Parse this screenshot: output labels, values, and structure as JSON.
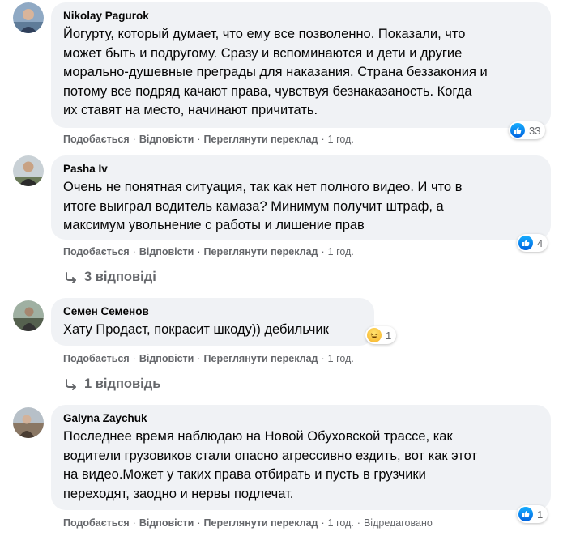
{
  "actions": {
    "like": "Подобається",
    "reply": "Відповісти",
    "translate": "Переглянути переклад"
  },
  "comments": [
    {
      "author": "Nikolay Pagurok",
      "lines": [
        "Йогурту, который думает, что ему все позволенно. Показали, что",
        "может быть и подругому. Сразу и вспоминаются и дети и другие",
        "морально-душевные преграды для наказания. Страна беззакония и",
        "потому все подряд качают права, чувствуя безнаказаность. Когда",
        "их ставят на место, начинают причитать."
      ],
      "time": "1 год.",
      "reactions": {
        "icon": "like-icon",
        "count": "33"
      }
    },
    {
      "author": "Pasha Iv",
      "lines": [
        "Очень не понятная ситуация, так как нет полного видео. И что в",
        "итоге выиграл водитель камаза? Минимум получит штраф, а",
        "максимум увольнение с работы и лишение прав"
      ],
      "time": "1 год.",
      "reactions": {
        "icon": "like-icon",
        "count": "4"
      },
      "replies": "3 відповіді"
    },
    {
      "author": "Семен Семенов",
      "lines": [
        "Хату Продаст, покрасит шкоду)) дебильчик"
      ],
      "time": "1 год.",
      "reactions": {
        "icon": "haha-icon",
        "count": "1"
      },
      "replies": "1 відповідь"
    },
    {
      "author": "Galyna Zaychuk",
      "lines": [
        "Последнее время наблюдаю на Новой Обуховской трассе, как",
        "водители грузовиков стали опасно агрессивно ездить, вот как этот",
        "на видео.Может у таких права отбирать и пусть в грузчики",
        "переходят, заодно и нервы подлечат."
      ],
      "time": "1 год.",
      "edited": "Відредаговано",
      "reactions": {
        "icon": "like-icon",
        "count": "1"
      }
    }
  ],
  "colors": {
    "bubble": "#f0f2f5",
    "secondary_text": "#65676b",
    "like_blue": "#1877f2"
  }
}
